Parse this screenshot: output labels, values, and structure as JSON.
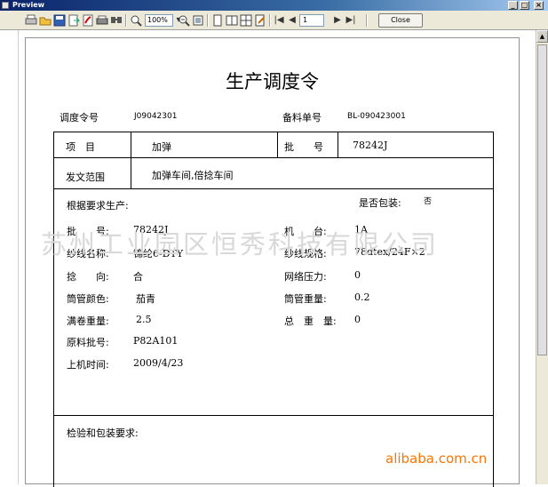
{
  "window": {
    "title": "Preview",
    "minimize": "_",
    "maximize": "□",
    "close": "×"
  },
  "toolbar": {
    "zoom": "100%",
    "page": "1",
    "close_label": "Close"
  },
  "doc": {
    "title": "生产调度令",
    "order_label": "调度令号",
    "order_value": "J09042301",
    "material_label": "备料单号",
    "material_value": "BL-090423001",
    "item_label": "项　目",
    "item_value": "加弹",
    "batch_label": "批　　号",
    "batch_value": "78242J",
    "scope_label": "发文范围",
    "scope_value": "加弹车间,倍捻车间",
    "intro": "根据要求生产:",
    "pack_label": "是否包装:",
    "pack_value": "否",
    "fields": [
      {
        "label": "批　　号:",
        "value": "78242J"
      },
      {
        "label": "纱线名称:",
        "value": "锦纶6-DTY"
      },
      {
        "label": "捻　　向:",
        "value": "合"
      },
      {
        "label": "筒管颜色:",
        "value": "茄青"
      },
      {
        "label": "满卷重量:",
        "value": "2.5"
      },
      {
        "label": "原料批号:",
        "value": "P82A101"
      },
      {
        "label": "上机时间:",
        "value": "2009/4/23"
      }
    ],
    "fields_right": [
      {
        "label": "机　　台:",
        "value": "1A"
      },
      {
        "label": "纱线规格:",
        "value": "78dtex/24F×2"
      },
      {
        "label": "网络压力:",
        "value": "0"
      },
      {
        "label": "筒管重量:",
        "value": "0.2"
      },
      {
        "label": "总　重　量:",
        "value": "0"
      }
    ],
    "inspection_label": "检验和包装要求:"
  },
  "watermark": "苏州工业园区恒秀科技有限公司",
  "site_mark": "alibaba.com.cn"
}
